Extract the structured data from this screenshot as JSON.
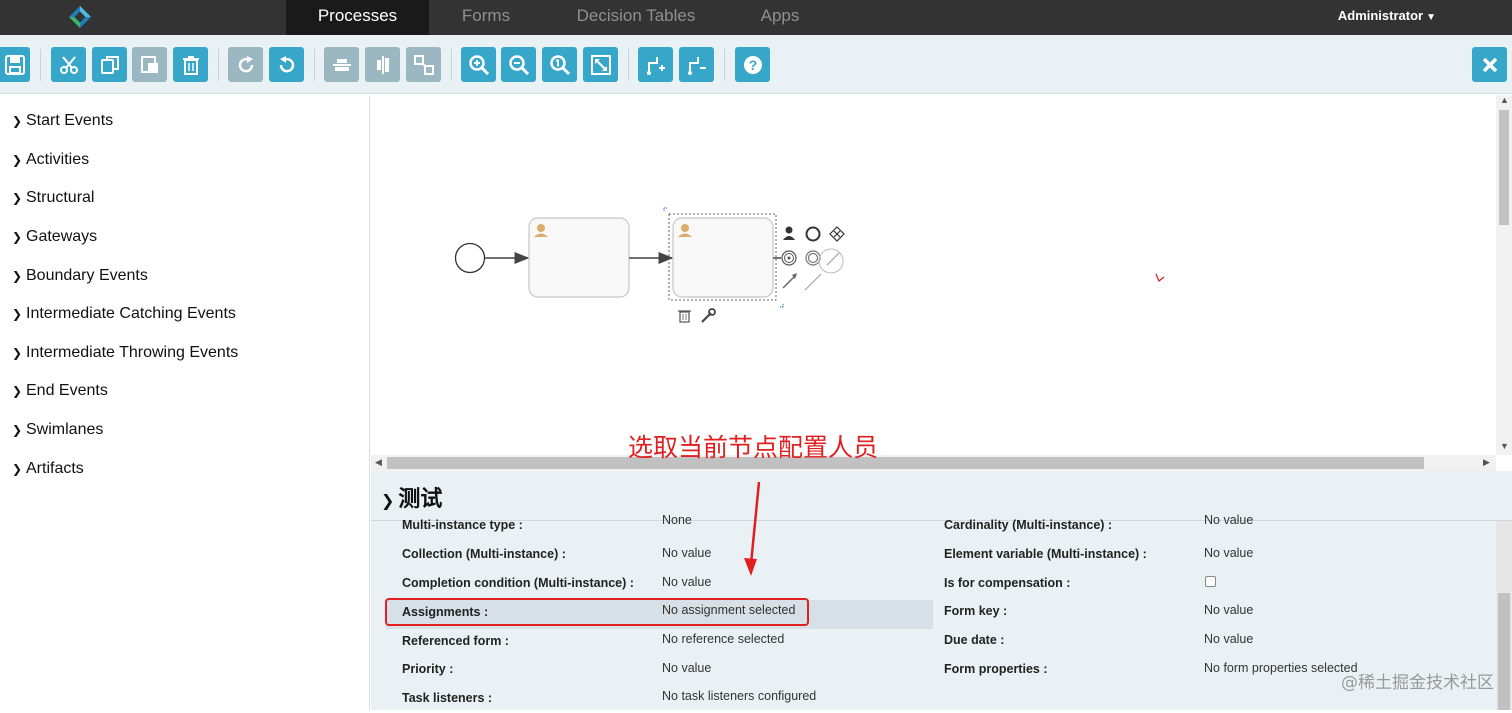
{
  "topnav": {
    "tabs": [
      {
        "label": "Processes",
        "active": true
      },
      {
        "label": "Forms",
        "active": false
      },
      {
        "label": "Decision Tables",
        "active": false
      },
      {
        "label": "Apps",
        "active": false
      }
    ],
    "user": "Administrator"
  },
  "toolbar": {
    "buttons": [
      "save-icon",
      "cut-icon",
      "copy-icon",
      "paste-icon",
      "delete-icon",
      "redo-icon",
      "undo-icon",
      "align-horizontal-icon",
      "align-vertical-icon",
      "same-size-icon",
      "zoom-in-icon",
      "zoom-out-icon",
      "zoom-actual-icon",
      "zoom-fit-icon",
      "add-bendpoint-icon",
      "remove-bendpoint-icon",
      "help-icon",
      "close-icon"
    ],
    "accent": "#36a6c9",
    "disabled": "#9bb7c1"
  },
  "palette": {
    "items": [
      "Start Events",
      "Activities",
      "Structural",
      "Gateways",
      "Boundary Events",
      "Intermediate Catching Events",
      "Intermediate Throwing Events",
      "End Events",
      "Swimlanes",
      "Artifacts"
    ]
  },
  "annotation": "选取当前节点配置人员",
  "properties": {
    "title": "测试",
    "left": [
      {
        "label": "Multi-instance type :",
        "value": "None"
      },
      {
        "label": "Collection (Multi-instance) :",
        "value": "No value"
      },
      {
        "label": "Completion condition (Multi-instance) :",
        "value": "No value"
      },
      {
        "label": "Assignments :",
        "value": "No assignment selected"
      },
      {
        "label": "Referenced form :",
        "value": "No reference selected"
      },
      {
        "label": "Priority :",
        "value": "No value"
      },
      {
        "label": "Task listeners :",
        "value": "No task listeners configured"
      }
    ],
    "right": [
      {
        "label": "Cardinality (Multi-instance) :",
        "value": "No value"
      },
      {
        "label": "Element variable (Multi-instance) :",
        "value": "No value"
      },
      {
        "label": "Is for compensation :",
        "value": ""
      },
      {
        "label": "Form key :",
        "value": "No value"
      },
      {
        "label": "Due date :",
        "value": "No value"
      },
      {
        "label": "Form properties :",
        "value": "No form properties selected"
      }
    ]
  },
  "watermark": "@稀土掘金技术社区",
  "colors": {
    "annotation": "#e02020",
    "nav": "#333333",
    "panel": "#eaf1f4"
  }
}
